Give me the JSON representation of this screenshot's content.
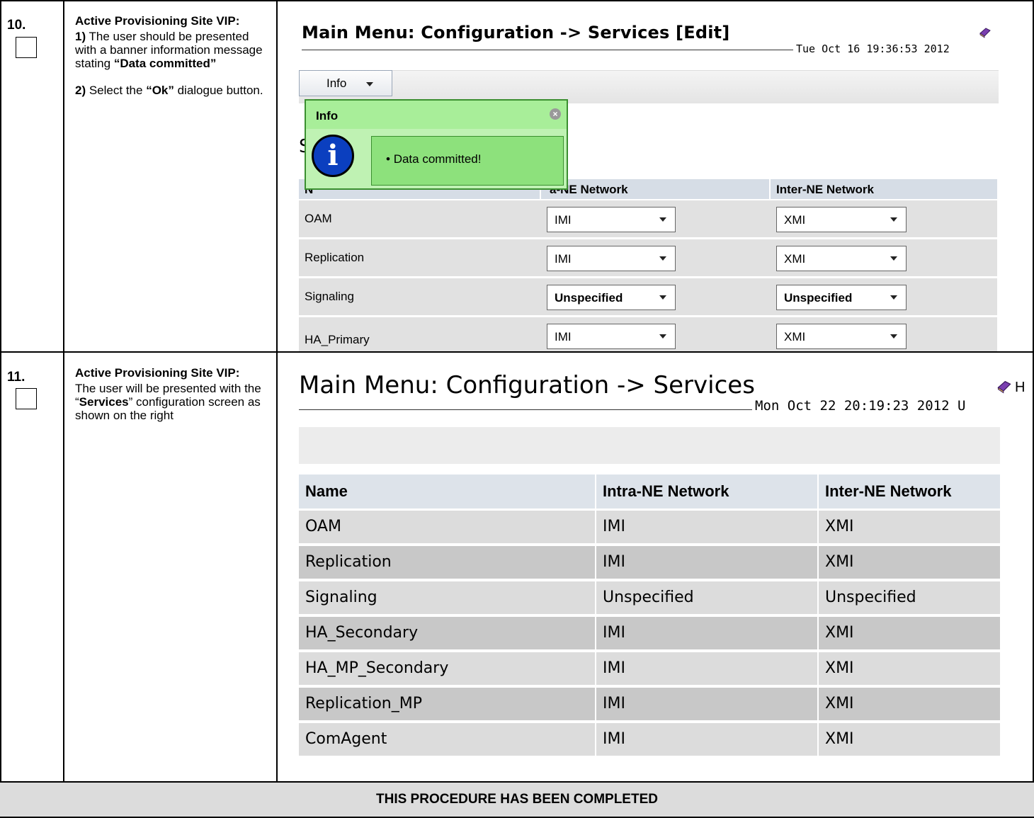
{
  "steps": [
    {
      "number": "10.",
      "heading": "Active Provisioning Site VIP:",
      "line1_bold": "1)",
      "line1_text": " The user should be presented with a banner information message stating ",
      "line1_quote": "“Data committed”",
      "line2_bold": "2)",
      "line2_text_pre": " Select the ",
      "line2_quote": "“Ok”",
      "line2_text_post": " dialogue button."
    },
    {
      "number": "11.",
      "heading": "Active Provisioning Site VIP:",
      "text_pre": "The user will be presented with the “",
      "text_bold": "Services",
      "text_post": "” configuration screen as shown on the right"
    }
  ],
  "screenshot1": {
    "title": "Main Menu: Configuration -> Services [Edit]",
    "datetime": "Tue Oct 16 19:36:53 2012",
    "info_button": "Info",
    "popup_title": "Info",
    "popup_message": "Data committed!",
    "partial_heading": "S",
    "columns": [
      "Name",
      "Intra-NE Network",
      "Inter-NE Network"
    ],
    "columns_visible": [
      "N",
      "a-NE Network",
      "Inter-NE Network"
    ],
    "rows": [
      {
        "name": "OAM",
        "intra": "IMI",
        "inter": "XMI"
      },
      {
        "name": "Replication",
        "intra": "IMI",
        "inter": "XMI"
      },
      {
        "name": "Signaling",
        "intra": "Unspecified",
        "inter": "Unspecified"
      },
      {
        "name": "HA_Primary",
        "intra": "IMI",
        "inter": "XMI"
      }
    ]
  },
  "screenshot2": {
    "title": "Main Menu: Configuration -> Services",
    "datetime": "Mon Oct 22 20:19:23 2012 U",
    "help_partial": "H",
    "columns": [
      "Name",
      "Intra-NE Network",
      "Inter-NE Network"
    ],
    "rows": [
      {
        "name": "OAM",
        "intra": "IMI",
        "inter": "XMI"
      },
      {
        "name": "Replication",
        "intra": "IMI",
        "inter": "XMI"
      },
      {
        "name": "Signaling",
        "intra": "Unspecified",
        "inter": "Unspecified"
      },
      {
        "name": "HA_Secondary",
        "intra": "IMI",
        "inter": "XMI"
      },
      {
        "name": "HA_MP_Secondary",
        "intra": "IMI",
        "inter": "XMI"
      },
      {
        "name": "Replication_MP",
        "intra": "IMI",
        "inter": "XMI"
      },
      {
        "name": "ComAgent",
        "intra": "IMI",
        "inter": "XMI"
      }
    ]
  },
  "footer": "THIS PROCEDURE HAS BEEN COMPLETED",
  "colors": {
    "popup_bg": "#bff2b3",
    "popup_border": "#3a8f2f",
    "info_icon": "#0b3fbf",
    "footer_bg": "#dcdcdc"
  }
}
